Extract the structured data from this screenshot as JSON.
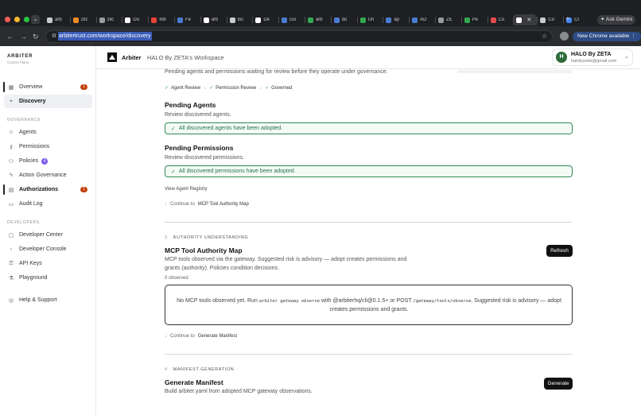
{
  "browser": {
    "tabs": [
      {
        "label": "arb",
        "color": "#c9cacc"
      },
      {
        "label": "zilc",
        "color": "#f28c28"
      },
      {
        "label": "zilc",
        "color": "#9a9ba0"
      },
      {
        "label": "Do",
        "color": "#ffffff"
      },
      {
        "label": "Inb",
        "color": "#ea4335"
      },
      {
        "label": "Fe",
        "color": "#4a7bd4"
      },
      {
        "label": "arb",
        "color": "#ffffff"
      },
      {
        "label": "loc",
        "color": "#c9cacc"
      },
      {
        "label": "De",
        "color": "#ffffff"
      },
      {
        "label": "Go",
        "color": "#4a7bd4"
      },
      {
        "label": "arb",
        "color": "#34a853"
      },
      {
        "label": "do",
        "color": "#4a7bd4"
      },
      {
        "label": "Un",
        "color": "#34a853"
      },
      {
        "label": "ap",
        "color": "#4a7bd4"
      },
      {
        "label": "AD",
        "color": "#4a7bd4"
      },
      {
        "label": "ZE",
        "color": "#9a9ba0"
      },
      {
        "label": "Pe",
        "color": "#34a853"
      },
      {
        "label": "Co",
        "color": "#e34c4c"
      },
      {
        "label": "",
        "color": "#ffffff"
      },
      {
        "label": "Co",
        "color": "#c9cacc"
      },
      {
        "label": "Cr",
        "color": "#4285f4"
      }
    ],
    "new_tab": "+",
    "gemini_label": "✦ Ask Gemini",
    "url": "arbitertrust.com/workspace/discovery",
    "chrome_available": "New Chrome available ⋮"
  },
  "header": {
    "app_name": "Arbiter",
    "workspace": "HALO By ZETA's Workspace",
    "user_name": "HALO By ZETA",
    "user_email": "halobyzeta@gmail.com",
    "avatar_initial": "H"
  },
  "sidebar": {
    "brand": "ARBITER",
    "brand_sub": "Control Plane",
    "overview": {
      "label": "Overview",
      "badge": "1"
    },
    "discovery": {
      "label": "Discovery"
    },
    "governance_title": "GOVERNANCE",
    "agents": "Agents",
    "permissions": "Permissions",
    "policies": {
      "label": "Policies",
      "badge": "4"
    },
    "action_governance": "Action Governance",
    "authorizations": {
      "label": "Authorizations",
      "badge": "1"
    },
    "audit_log": "Audit Log",
    "developers_title": "DEVELOPERS",
    "developer_center": "Developer Center",
    "developer_console": "Developer Console",
    "api_keys": "API Keys",
    "playground": "Playground",
    "help": "Help & Support"
  },
  "main": {
    "intro": "Pending agents and permissions waiting for review before they operate under governance.",
    "steps": [
      "Agent Review",
      "Permission Review",
      "Governed"
    ],
    "pending_agents": {
      "title": "Pending Agents",
      "desc": "Review discovered agents.",
      "success": "All discovered agents have been adopted."
    },
    "pending_permissions": {
      "title": "Pending Permissions",
      "desc": "Review discovered permissions.",
      "success": "All discovered permissions have been adopted."
    },
    "view_registry": "View Agent Registry",
    "continue1": {
      "prefix": "Continue to",
      "target": "MCP Tool Authority Map"
    },
    "section3": {
      "num": "3",
      "label": "AUTHORITY UNDERSTANDING"
    },
    "mcp": {
      "title": "MCP Tool Authority Map",
      "desc1": "MCP tools observed via the gateway. Suggested risk is advisory — adopt creates permissions and",
      "desc2": "grants (authority). Policies condition decisions.",
      "count": "0 observed",
      "refresh": "Refresh",
      "empty_a": "No MCP tools observed yet. Run ",
      "empty_code1": "arbiter gateway observe",
      "empty_b": " with @arbiterhq/cli@0.1.5+ or POST ",
      "empty_code2": "/gateway/tools/observe",
      "empty_c": ". Suggested risk is advisory — adopt",
      "empty_d": "creates permissions and grants."
    },
    "continue2": {
      "prefix": "Continue to",
      "target": "Generate Manifest"
    },
    "section4": {
      "num": "4",
      "label": "MANIFEST GENERATION"
    },
    "manifest": {
      "title": "Generate Manifest",
      "desc": "Build arbiter.yaml from adopted MCP gateway observations.",
      "button": "Generate"
    }
  }
}
